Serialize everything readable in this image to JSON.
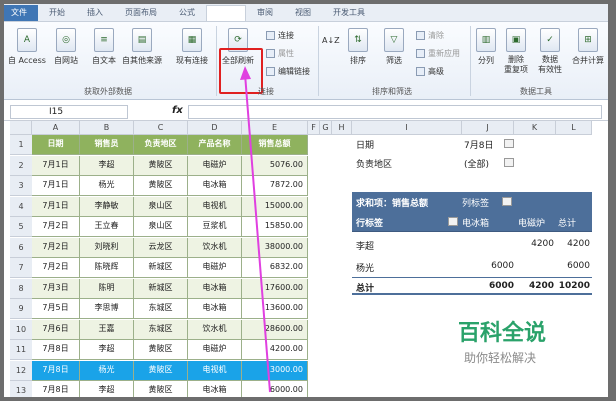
{
  "tabs": [
    "文件",
    "开始",
    "插入",
    "页面布局",
    "公式",
    "数据",
    "审阅",
    "视图",
    "开发工具"
  ],
  "ribbon": {
    "buttons": [
      "自 Access",
      "自网站",
      "自文本",
      "自其他来源",
      "现有连接",
      "全部刷新"
    ],
    "small": [
      "连接",
      "属性",
      "编辑链接",
      "清除",
      "重新应用",
      "高级",
      "排序",
      "筛选"
    ],
    "tools": [
      "分列",
      "删除\n重复项",
      "数据\n有效性",
      "合并计算"
    ],
    "groups": [
      "获取外部数据",
      "连接",
      "排序和筛选",
      "数据工具"
    ]
  },
  "formula": {
    "cell": "I15",
    "fx": "fx"
  },
  "columns": [
    "A",
    "B",
    "C",
    "D",
    "E",
    "F",
    "G",
    "H",
    "I",
    "J",
    "K",
    "L"
  ],
  "rows": [
    "1",
    "2",
    "3",
    "4",
    "5",
    "6",
    "7",
    "8",
    "9",
    "10",
    "11",
    "12",
    "13"
  ],
  "table": {
    "headers": [
      "日期",
      "销售员",
      "负责地区",
      "产品名称",
      "销售总额"
    ],
    "data": [
      [
        "7月1日",
        "李超",
        "黄陂区",
        "电磁炉",
        "5076.00"
      ],
      [
        "7月1日",
        "杨光",
        "黄陂区",
        "电冰箱",
        "7872.00"
      ],
      [
        "7月1日",
        "李静敏",
        "泉山区",
        "电视机",
        "15000.00"
      ],
      [
        "7月2日",
        "王立春",
        "泉山区",
        "豆浆机",
        "15850.00"
      ],
      [
        "7月2日",
        "刘晓利",
        "云龙区",
        "饮水机",
        "38000.00"
      ],
      [
        "7月2日",
        "陈晓辉",
        "新城区",
        "电磁炉",
        "6832.00"
      ],
      [
        "7月3日",
        "陈明",
        "新城区",
        "电冰箱",
        "17600.00"
      ],
      [
        "7月5日",
        "李思博",
        "东城区",
        "电冰箱",
        "13600.00"
      ],
      [
        "7月6日",
        "王嘉",
        "东城区",
        "饮水机",
        "28600.00"
      ],
      [
        "7月8日",
        "李超",
        "黄陂区",
        "电磁炉",
        "4200.00"
      ],
      [
        "7月8日",
        "杨光",
        "黄陂区",
        "电视机",
        "3000.00"
      ],
      [
        "7月8日",
        "李超",
        "黄陂区",
        "电冰箱",
        "6000.00"
      ]
    ]
  },
  "pivot": {
    "filter1_label": "日期",
    "filter1_value": "7月8日",
    "filter2_label": "负责地区",
    "filter2_value": "(全部)",
    "title": "求和项：销售总额",
    "col_label": "列标签",
    "row_label": "行标签",
    "cols": [
      "电冰箱",
      "电磁炉",
      "总计"
    ],
    "rows": [
      {
        "name": "李超",
        "v1": "",
        "v2": "4200",
        "v3": "4200"
      },
      {
        "name": "杨光",
        "v1": "6000",
        "v2": "",
        "v3": "6000"
      }
    ],
    "total": {
      "name": "总计",
      "v1": "6000",
      "v2": "4200",
      "v3": "10200"
    }
  },
  "watermark": {
    "title": "百科全说",
    "subtitle": "助你轻松解决"
  }
}
